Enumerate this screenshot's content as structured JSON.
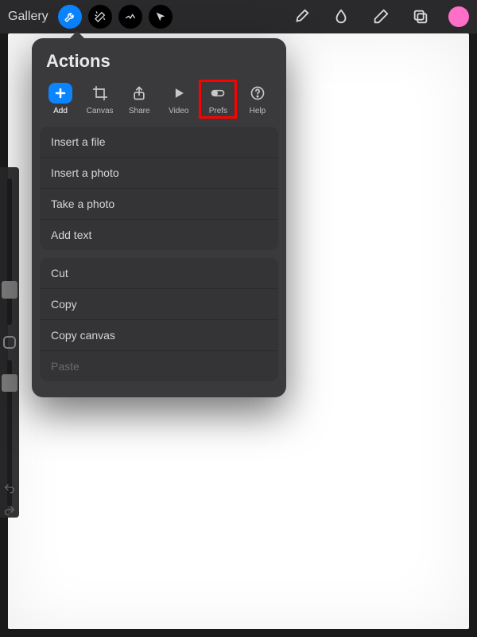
{
  "topbar": {
    "gallery_label": "Gallery"
  },
  "colors": {
    "accent": "#0a84ff",
    "swatch": "#ff6fc8",
    "highlight": "#ff0000"
  },
  "popover": {
    "title": "Actions",
    "tabs": [
      {
        "id": "add",
        "label": "Add",
        "active": true
      },
      {
        "id": "canvas",
        "label": "Canvas"
      },
      {
        "id": "share",
        "label": "Share"
      },
      {
        "id": "video",
        "label": "Video"
      },
      {
        "id": "prefs",
        "label": "Prefs",
        "highlighted": true
      },
      {
        "id": "help",
        "label": "Help"
      }
    ],
    "groups": [
      [
        {
          "label": "Insert a file"
        },
        {
          "label": "Insert a photo"
        },
        {
          "label": "Take a photo"
        },
        {
          "label": "Add text"
        }
      ],
      [
        {
          "label": "Cut"
        },
        {
          "label": "Copy"
        },
        {
          "label": "Copy canvas"
        },
        {
          "label": "Paste",
          "disabled": true
        }
      ]
    ]
  }
}
